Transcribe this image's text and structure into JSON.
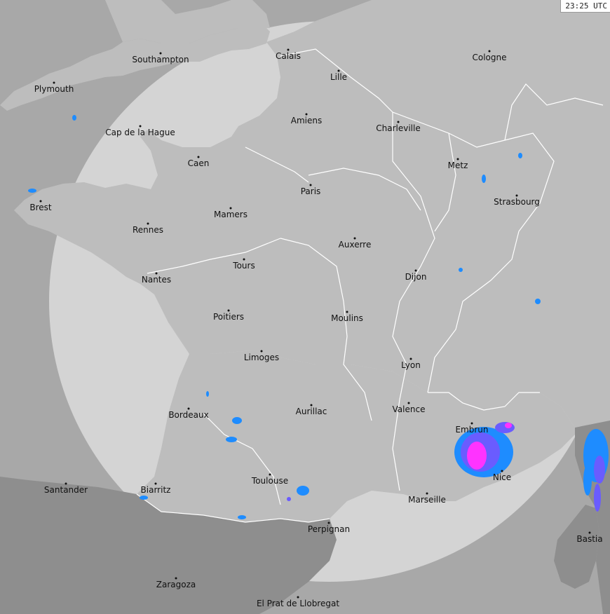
{
  "timestamp": "23:25 UTC",
  "colors": {
    "sea": "#d4d4d4",
    "coverage_land": "#bdbdbd",
    "outside_land": "#8e8e8e",
    "outside_sea": "#a8a8a8",
    "borders": "#ffffff",
    "lightning_low": "#1e8cff",
    "lightning_mid": "#6a5cff",
    "lightning_high": "#ff33ff"
  },
  "cities": [
    "Southampton",
    "Plymouth",
    "Calais",
    "Lille",
    "Cologne",
    "Amiens",
    "Charleville",
    "Cap de la Hague",
    "Caen",
    "Metz",
    "Paris",
    "Strasbourg",
    "Brest",
    "Mamers",
    "Rennes",
    "Auxerre",
    "Tours",
    "Nantes",
    "Dijon",
    "Poitiers",
    "Moulins",
    "Limoges",
    "Lyon",
    "Valence",
    "Bordeaux",
    "Aurillac",
    "Embrun",
    "Nice",
    "Santander",
    "Biarritz",
    "Toulouse",
    "Marseille",
    "Perpignan",
    "Bastia",
    "Zaragoza",
    "El Prat de Llobregat"
  ]
}
